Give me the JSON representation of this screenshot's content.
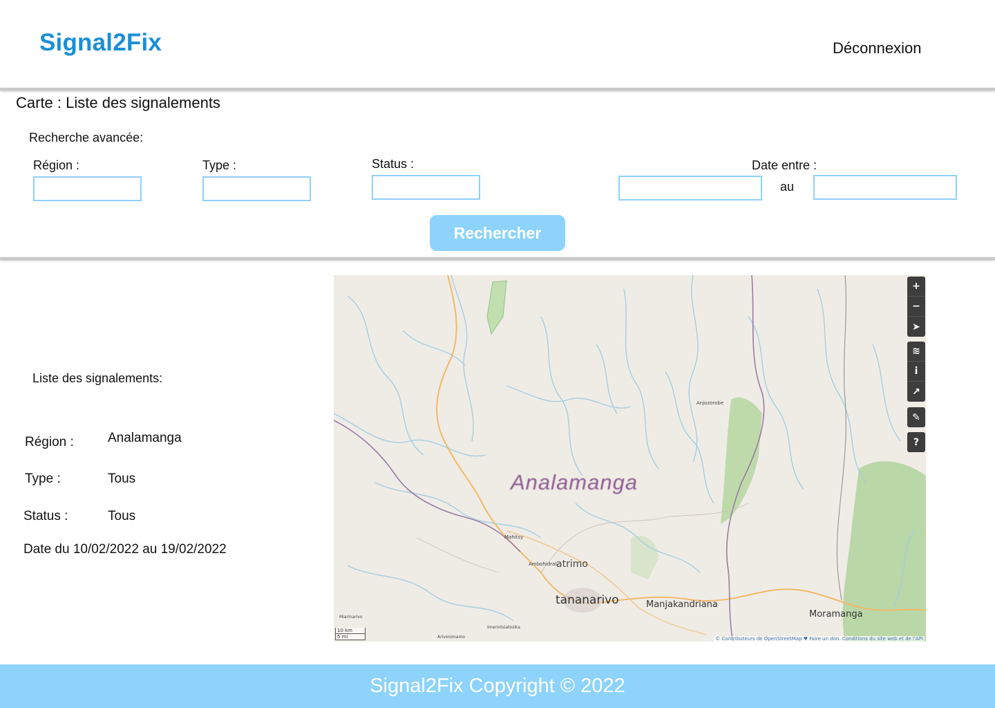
{
  "header": {
    "logo": "Signal2Fix",
    "logout_label": "Déconnexion"
  },
  "page": {
    "title": "Carte : Liste des signalements"
  },
  "search": {
    "section_label": "Recherche avancée:",
    "region_label": "Région :",
    "type_label": "Type :",
    "status_label": "Status :",
    "date_label": "Date entre :",
    "date_separator": "au",
    "region_value": "",
    "type_value": "",
    "status_value": "",
    "date_from_value": "",
    "date_to_value": "",
    "button_label": "Rechercher"
  },
  "list": {
    "title": "Liste des signalements:",
    "region_key": "Région :",
    "region_value": "Analamanga",
    "type_key": "Type :",
    "type_value": "Tous",
    "status_key": "Status :",
    "status_value": "Tous",
    "date_range": "Date du 10/02/2022 au 19/02/2022"
  },
  "map": {
    "region_label": "Analamanga",
    "places": {
      "anjozorobe": "Anjozorobe",
      "mahitsy": "Mahitsy",
      "ambohidratrimo_prefix": "Ambohidrat",
      "ambohidratrimo_suffix": "atrimo",
      "antananarivo": "tananarivo",
      "manjakandriana": "Manjakandriana",
      "moramanga": "Moramanga",
      "miarinarivo": "Miarinarivo",
      "imerintsiatosika": "Imerintsiatosika",
      "arivonimamo": "Arivonimamo"
    },
    "scale_km": "10 km",
    "scale_mi": "5 mi",
    "attribution": "© Contributeurs de OpenStreetMap ♥ Faire un don. Conditions du site web et de l'API",
    "controls": {
      "zoom_in": "+",
      "zoom_out": "−",
      "locate": "➤",
      "layers": "≋",
      "info": "i",
      "share": "↗",
      "note": "✎",
      "query": "?"
    }
  },
  "footer": {
    "text": "Signal2Fix Copyright ©  2022"
  }
}
